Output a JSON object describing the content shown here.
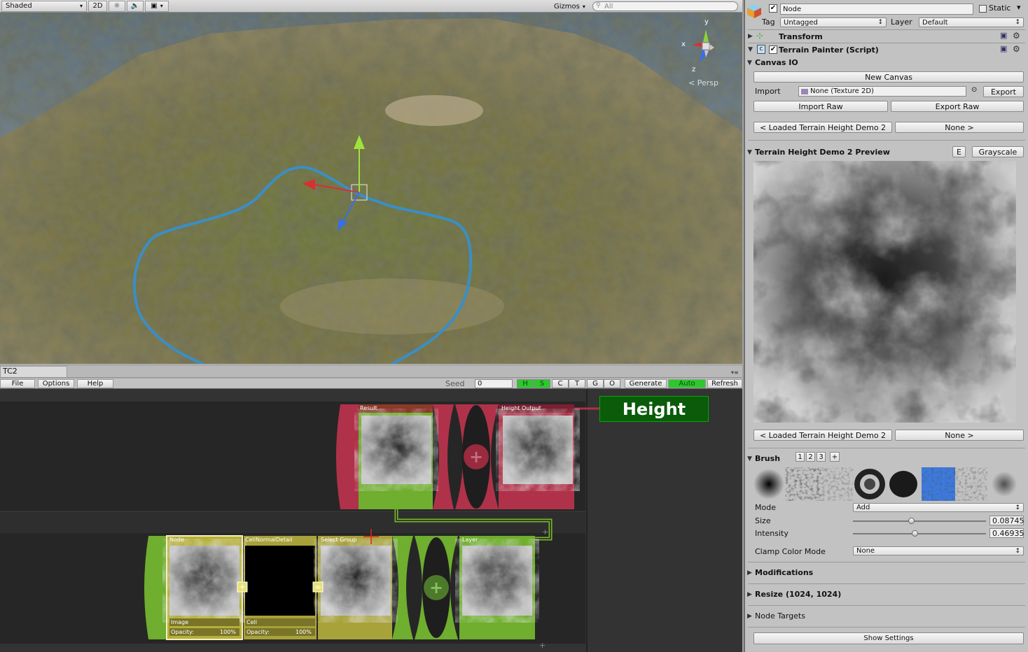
{
  "scene": {
    "toolbar": {
      "shading_mode": "Shaded",
      "mode_2d": "2D",
      "gizmos": "Gizmos",
      "search_placeholder": "All"
    },
    "projection": "Persp",
    "axes": {
      "y": "y",
      "x": "x",
      "z": "z"
    }
  },
  "graph": {
    "tab_title": "TC2",
    "menus": [
      "File",
      "Options",
      "Help"
    ],
    "seed_label": "Seed",
    "seed_value": "0",
    "toggles": [
      {
        "label": "H",
        "on": true
      },
      {
        "label": "S",
        "on": true
      },
      {
        "label": "C",
        "on": false
      },
      {
        "label": "T",
        "on": false
      },
      {
        "label": "G",
        "on": false
      },
      {
        "label": "O",
        "on": false
      }
    ],
    "generate": "Generate",
    "auto": "Auto",
    "refresh": "Refresh",
    "output_label": "Height",
    "top_nodes": {
      "result": "Result",
      "height_output": "Height Output"
    },
    "bottom_nodes": {
      "node": "Node",
      "cell_normal": "CellNormalDetail",
      "select_group": "Select Group",
      "layer": "Layer",
      "image_label": "Image",
      "cell_label": "Cell",
      "opacity_label": "Opacity:",
      "opacity_value": "100%"
    }
  },
  "inspector": {
    "object_name": "Node",
    "static_label": "Static",
    "tag_label": "Tag",
    "tag_value": "Untagged",
    "layer_label": "Layer",
    "layer_value": "Default",
    "transform": "Transform",
    "script": "Terrain Painter (Script)",
    "canvas_io": "Canvas IO",
    "new_canvas": "New Canvas",
    "import_label": "Import",
    "import_value": "None (Texture 2D)",
    "export": "Export",
    "import_raw": "Import Raw",
    "export_raw": "Export Raw",
    "loaded_left": "< Loaded Terrain Height Demo 2",
    "loaded_right": "None >",
    "preview_title": "Terrain Height Demo 2 Preview",
    "e_button": "E",
    "grayscale": "Grayscale",
    "brush_title": "Brush",
    "brush_tabs": [
      "1",
      "2",
      "3",
      "+"
    ],
    "mode_label": "Mode",
    "mode_value": "Add",
    "size_label": "Size",
    "size_value": "0.08745",
    "size_fraction": 0.44,
    "intensity_label": "Intensity",
    "intensity_value": "0.46935",
    "intensity_fraction": 0.47,
    "clamp_label": "Clamp Color Mode",
    "clamp_value": "None",
    "modifications": "Modifications",
    "resize": "Resize (1024, 1024)",
    "node_targets": "Node Targets",
    "show_settings": "Show Settings"
  }
}
